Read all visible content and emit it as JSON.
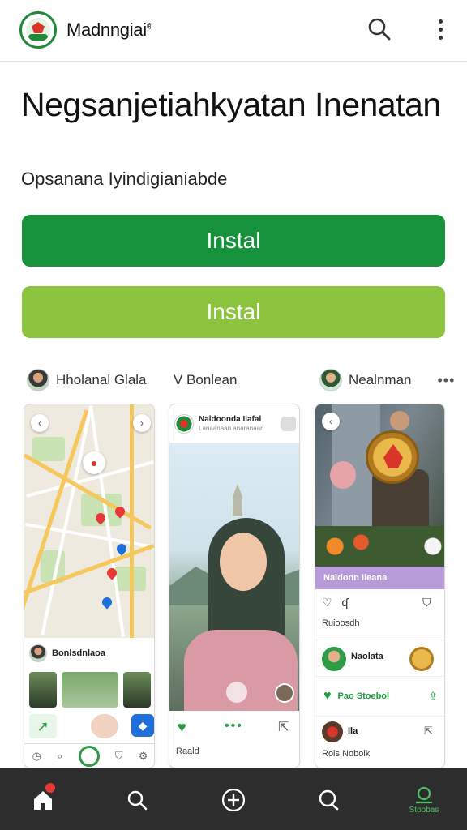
{
  "header": {
    "brand": "Madnngiai",
    "brand_mark": "®",
    "search_icon": "search-icon",
    "more_icon": "more-vert-icon"
  },
  "hero": {
    "title": "Negsanjetiahkyatan Inenatan",
    "subtitle": "Opsanana Iyindigianiabde"
  },
  "buttons": {
    "install_primary": "Instal",
    "install_secondary": "Instal",
    "primary_color": "#16923c",
    "secondary_color": "#8cc43f"
  },
  "screenshots": {
    "cards": [
      {
        "author": "Hholanal Glala",
        "rows": {
          "label": "Bonlsdnlaoa"
        }
      },
      {
        "author": "V Bonlean",
        "header_title": "Naldoonda Iiafal",
        "header_sub": "Lanaanaan anaranaan",
        "footer_label": "Raald"
      },
      {
        "author": "Nealnman",
        "more": "•••",
        "band": "Naldonn Ileana",
        "caption": "Ruioosdh",
        "profile": "Naolata",
        "action": "Pao Stoebol",
        "comment_user": "Ila",
        "comment_text": "Rols Nobolk"
      }
    ]
  },
  "bottom_nav": {
    "items": [
      {
        "icon": "home-icon"
      },
      {
        "icon": "search-icon"
      },
      {
        "icon": "add-circle-icon"
      },
      {
        "icon": "chat-icon"
      },
      {
        "icon": "profile-icon",
        "label": "Stoobas"
      }
    ],
    "active_color": "#4fbf63"
  }
}
